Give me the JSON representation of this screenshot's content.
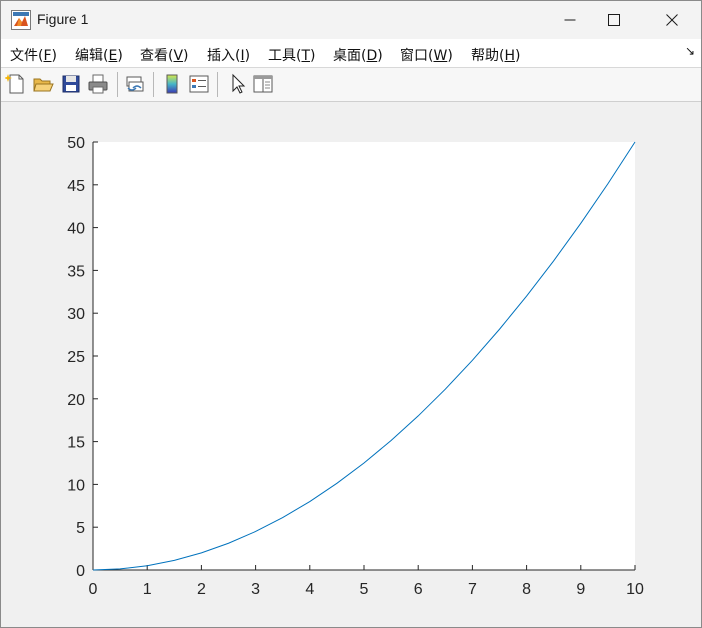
{
  "window": {
    "title": "Figure 1",
    "icon": "matlab-logo-icon",
    "controls": [
      "minimize-icon",
      "maximize-icon",
      "close-icon"
    ]
  },
  "menubar": {
    "items": [
      {
        "label": "文件(",
        "key": "F",
        "end": ")"
      },
      {
        "label": "编辑(",
        "key": "E",
        "end": ")"
      },
      {
        "label": "查看(",
        "key": "V",
        "end": ")"
      },
      {
        "label": "插入(",
        "key": "I",
        "end": ")"
      },
      {
        "label": "工具(",
        "key": "T",
        "end": ")"
      },
      {
        "label": "桌面(",
        "key": "D",
        "end": ")"
      },
      {
        "label": "窗口(",
        "key": "W",
        "end": ")"
      },
      {
        "label": "帮助(",
        "key": "H",
        "end": ")"
      }
    ],
    "overflow_glyph": "↘"
  },
  "toolbar": {
    "buttons": [
      "new-figure-icon",
      "open-file-icon",
      "save-icon",
      "print-icon",
      "link-plot-icon",
      "insert-colorbar-icon",
      "insert-legend-icon",
      "edit-plot-pointer-icon",
      "property-inspector-icon"
    ]
  },
  "colors": {
    "line": "#0072bd",
    "axes_bg": "#ffffff",
    "figure_bg": "#f0f0f0"
  },
  "chart_data": {
    "type": "line",
    "title": "",
    "xlabel": "",
    "ylabel": "",
    "xlim": [
      0,
      10
    ],
    "ylim": [
      0,
      50
    ],
    "xticks": [
      "0",
      "1",
      "2",
      "3",
      "4",
      "5",
      "6",
      "7",
      "8",
      "9",
      "10"
    ],
    "yticks": [
      "0",
      "5",
      "10",
      "15",
      "20",
      "25",
      "30",
      "35",
      "40",
      "45",
      "50"
    ],
    "grid": false,
    "series": [
      {
        "color": "#0072bd",
        "x": [
          0,
          0.5,
          1,
          1.5,
          2,
          2.5,
          3,
          3.5,
          4,
          4.5,
          5,
          5.5,
          6,
          6.5,
          7,
          7.5,
          8,
          8.5,
          9,
          9.5,
          10
        ],
        "y": [
          0,
          0.125,
          0.5,
          1.125,
          2,
          3.125,
          4.5,
          6.125,
          8,
          10.125,
          12.5,
          15.125,
          18,
          21.125,
          24.5,
          28.125,
          32,
          36.125,
          40.5,
          45.125,
          50
        ]
      }
    ]
  }
}
